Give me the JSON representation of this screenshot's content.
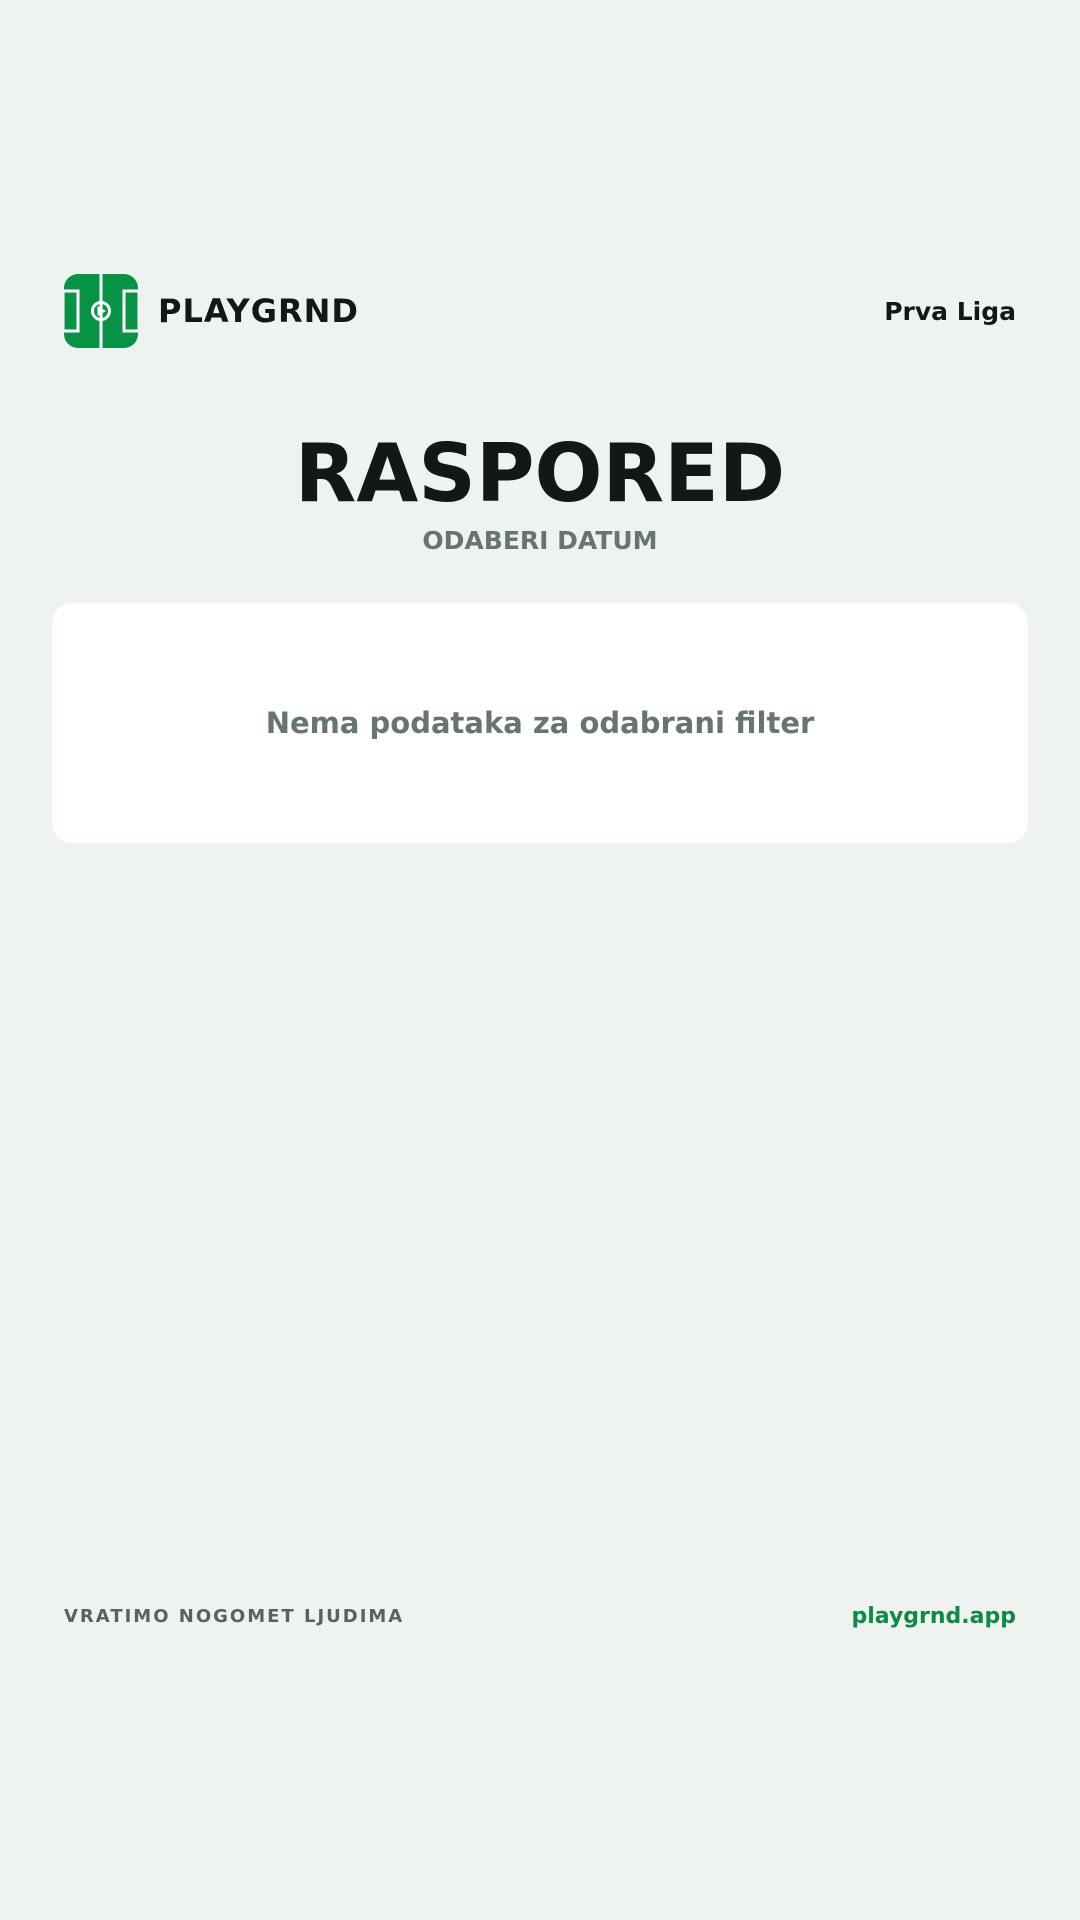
{
  "header": {
    "brand_name": "PLAYGRND",
    "league": "Prva Liga",
    "logo_icon": "soccer-field-icon",
    "brand_color": "#079346"
  },
  "main": {
    "title": "RASPORED",
    "subtitle": "ODABERI DATUM",
    "empty_message": "Nema podataka za odabrani filter"
  },
  "footer": {
    "tagline": "VRATIMO NOGOMET LJUDIMA",
    "link": "playgrnd.app",
    "link_color": "#0d8a45"
  },
  "theme": {
    "background": "#eff3f0",
    "card_background": "#ffffff",
    "muted_text": "#68756f"
  }
}
